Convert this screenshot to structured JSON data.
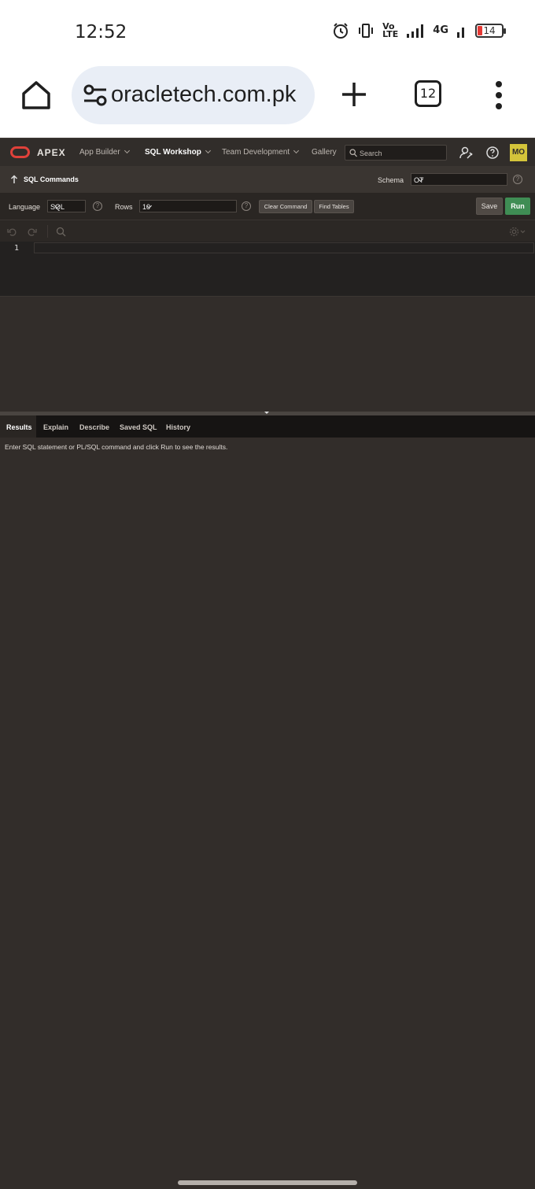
{
  "statusbar": {
    "time": "12:52",
    "volte": "Vo\nLTE",
    "network": "4G",
    "battery": "14"
  },
  "browser": {
    "url": "oracletech.com.pk",
    "tab_count": "12"
  },
  "apex": {
    "brand": "APEX",
    "nav": [
      "App Builder",
      "SQL Workshop",
      "Team Development",
      "Gallery"
    ],
    "search_placeholder": "Search",
    "avatar": "MO"
  },
  "titlebar": {
    "title": "SQL Commands",
    "schema_label": "Schema",
    "schema_value": "OT"
  },
  "toolbar": {
    "language_label": "Language",
    "language_value": "SQL",
    "rows_label": "Rows",
    "rows_value": "10",
    "clear_command": "Clear Command",
    "find_tables": "Find Tables",
    "save": "Save",
    "run": "Run"
  },
  "editor": {
    "line_number": "1"
  },
  "results": {
    "tabs": [
      "Results",
      "Explain",
      "Describe",
      "Saved SQL",
      "History"
    ],
    "message": "Enter SQL statement or PL/SQL command and click Run to see the results."
  }
}
